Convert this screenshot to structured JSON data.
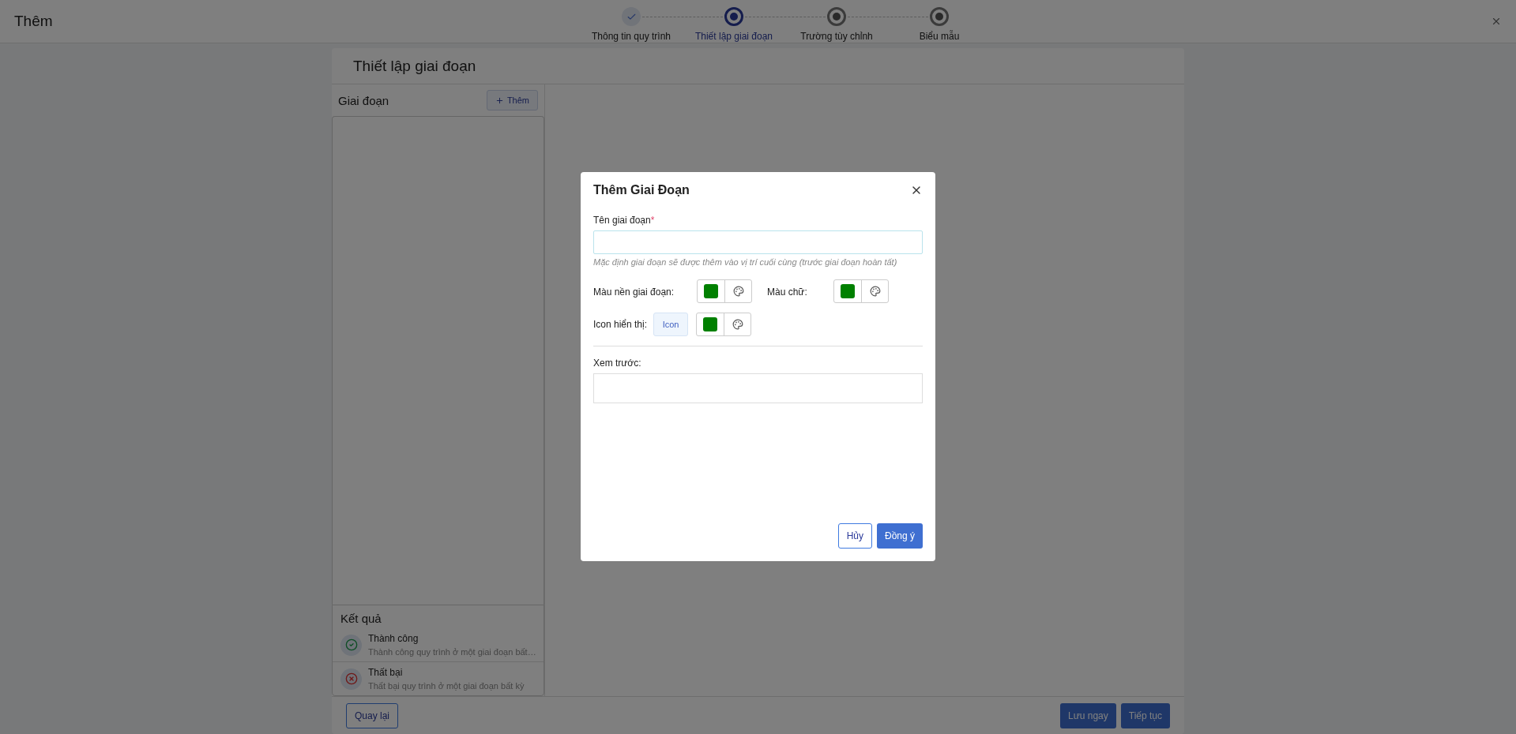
{
  "window": {
    "title": "Thêm"
  },
  "stepper": [
    {
      "label": "Thông tin quy trình",
      "kind": "done"
    },
    {
      "label": "Thiết lập giai đoạn",
      "kind": "current"
    },
    {
      "label": "Trường tùy chỉnh",
      "kind": "pending"
    },
    {
      "label": "Biểu mẫu",
      "kind": "pending"
    }
  ],
  "page": {
    "title": "Thiết lập giai đoạn",
    "stages_panel": {
      "title": "Giai đoạn",
      "add_button": "Thêm"
    },
    "results": {
      "title": "Kết quả",
      "items": [
        {
          "kind": "success",
          "title": "Thành công",
          "description": "Thành công quy trình ở một giai đoạn bất…"
        },
        {
          "kind": "failure",
          "title": "Thất bại",
          "description": "Thất bại quy trình ở một giai đoạn bất kỳ"
        }
      ]
    }
  },
  "footer": {
    "back_button": "Quay lại",
    "save_button": "Lưu ngay",
    "next_button": "Tiếp tục"
  },
  "dialog": {
    "title": "Thêm Giai Đoạn",
    "name_field": {
      "label": "Tên giai đoạn",
      "required_mark": "*",
      "hint": "Mặc định giai đoạn sẽ được thêm vào vị trí cuối cùng (trước giai đoạn hoàn tất)"
    },
    "background_color": {
      "label": "Màu nền giai đoạn:",
      "color": "#008000"
    },
    "text_color": {
      "label": "Màu chữ:",
      "color": "#008000"
    },
    "icon": {
      "label": "Icon hiển thị:",
      "button": "Icon",
      "color": "#008000"
    },
    "preview": {
      "label": "Xem trước:"
    },
    "cancel_button": "Hủy",
    "ok_button": "Đồng ý"
  }
}
